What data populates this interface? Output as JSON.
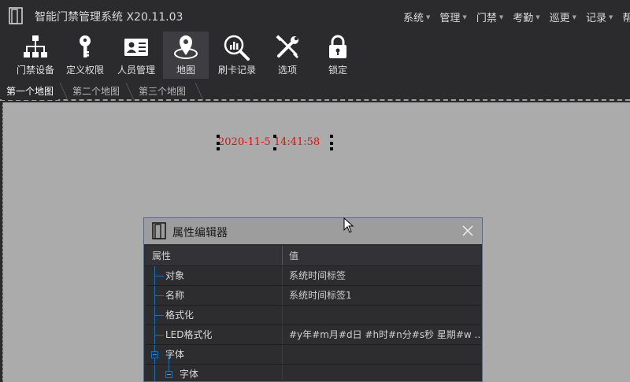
{
  "app": {
    "title": "智能门禁管理系统 X20.11.03"
  },
  "menu": [
    "系统",
    "管理",
    "门禁",
    "考勤",
    "巡更",
    "记录",
    "帮"
  ],
  "toolbar": [
    {
      "label": "门禁设备",
      "icon": "network-icon"
    },
    {
      "label": "定义权限",
      "icon": "key-icon"
    },
    {
      "label": "人员管理",
      "icon": "id-card-icon"
    },
    {
      "label": "地图",
      "icon": "map-pin-icon",
      "active": true
    },
    {
      "label": "刷卡记录",
      "icon": "chart-magnifier-icon"
    },
    {
      "label": "选项",
      "icon": "tools-icon"
    },
    {
      "label": "锁定",
      "icon": "lock-icon"
    }
  ],
  "tabs": [
    "第一个地图",
    "第二个地图",
    "第三个地图"
  ],
  "canvas": {
    "time_label": "2020-11-5 14:41:58"
  },
  "property_editor": {
    "title": "属性编辑器",
    "col_property": "属性",
    "col_value": "值",
    "rows": [
      {
        "name": "对象",
        "value": "系统时间标签"
      },
      {
        "name": "名称",
        "value": "系统时间标签1"
      },
      {
        "name": "格式化",
        "value": ""
      },
      {
        "name": "LED格式化",
        "value": "#y年#m月#d日 #h时#n分#s秒 星期#w ..."
      },
      {
        "name": "字体",
        "value": ""
      },
      {
        "name": "字体",
        "value": ""
      }
    ]
  },
  "colors": {
    "accent": "#1e6fb8",
    "time_text": "#ff0000",
    "canvas": "#ababab",
    "chrome": "#2b2b2d"
  }
}
